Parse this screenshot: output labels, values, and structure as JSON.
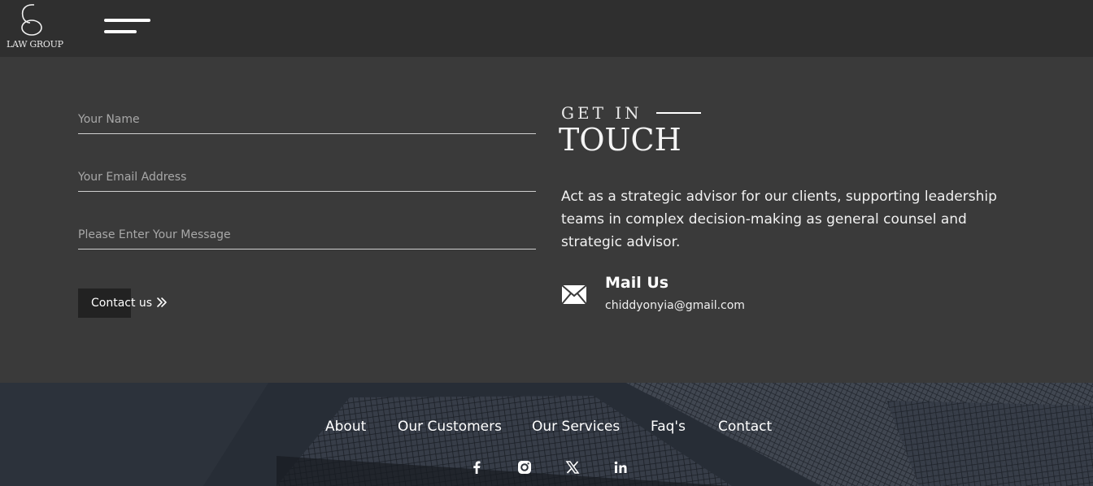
{
  "header": {
    "logo_text": "LAW GROUP",
    "menu_icon": "hamburger-menu-icon"
  },
  "form": {
    "name_placeholder": "Your Name",
    "email_placeholder": "Your Email Address",
    "message_placeholder": "Please Enter Your Message",
    "submit_label": "Contact us",
    "submit_icon": "double-chevron-right-icon"
  },
  "touch": {
    "eyebrow": "GET IN",
    "title": "TOUCH",
    "description": "Act as a strategic advisor for our clients, supporting leadership teams in complex decision-making as general counsel and strategic advisor.",
    "mail_heading": "Mail Us",
    "mail_address": "chiddyonyia@gmail.com",
    "mail_icon": "envelope-icon"
  },
  "footer": {
    "nav": [
      "About",
      "Our Customers",
      "Our Services",
      "Faq's",
      "Contact"
    ],
    "social_icons": [
      "facebook-icon",
      "instagram-icon",
      "x-icon",
      "linkedin-icon"
    ]
  },
  "colors": {
    "page_background": "#3a3a3a",
    "header_background": "#2f2f2f",
    "button_background": "#222222",
    "text": "#ffffff"
  }
}
